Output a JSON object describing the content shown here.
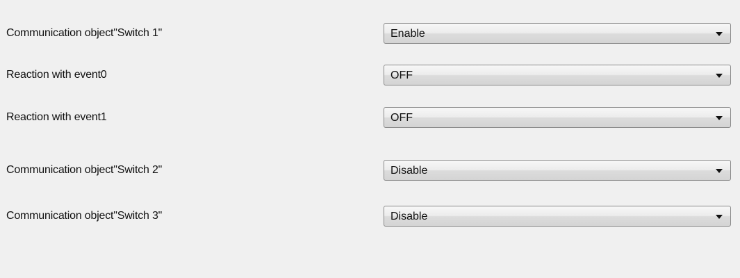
{
  "settings": {
    "rows": [
      {
        "label": "Communication object\"Switch 1\"",
        "value": "Enable"
      },
      {
        "label": "Reaction with event0",
        "value": "OFF"
      },
      {
        "label": "Reaction with event1",
        "value": "OFF"
      },
      {
        "label": "Communication object\"Switch 2\"",
        "value": "Disable"
      },
      {
        "label": "Communication object\"Switch 3\"",
        "value": "Disable"
      }
    ]
  },
  "icons": {
    "dropdown": "chevron-down-icon"
  },
  "colors": {
    "background": "#f0f0f0",
    "combo_border": "#8a8a8a",
    "text": "#111111"
  }
}
